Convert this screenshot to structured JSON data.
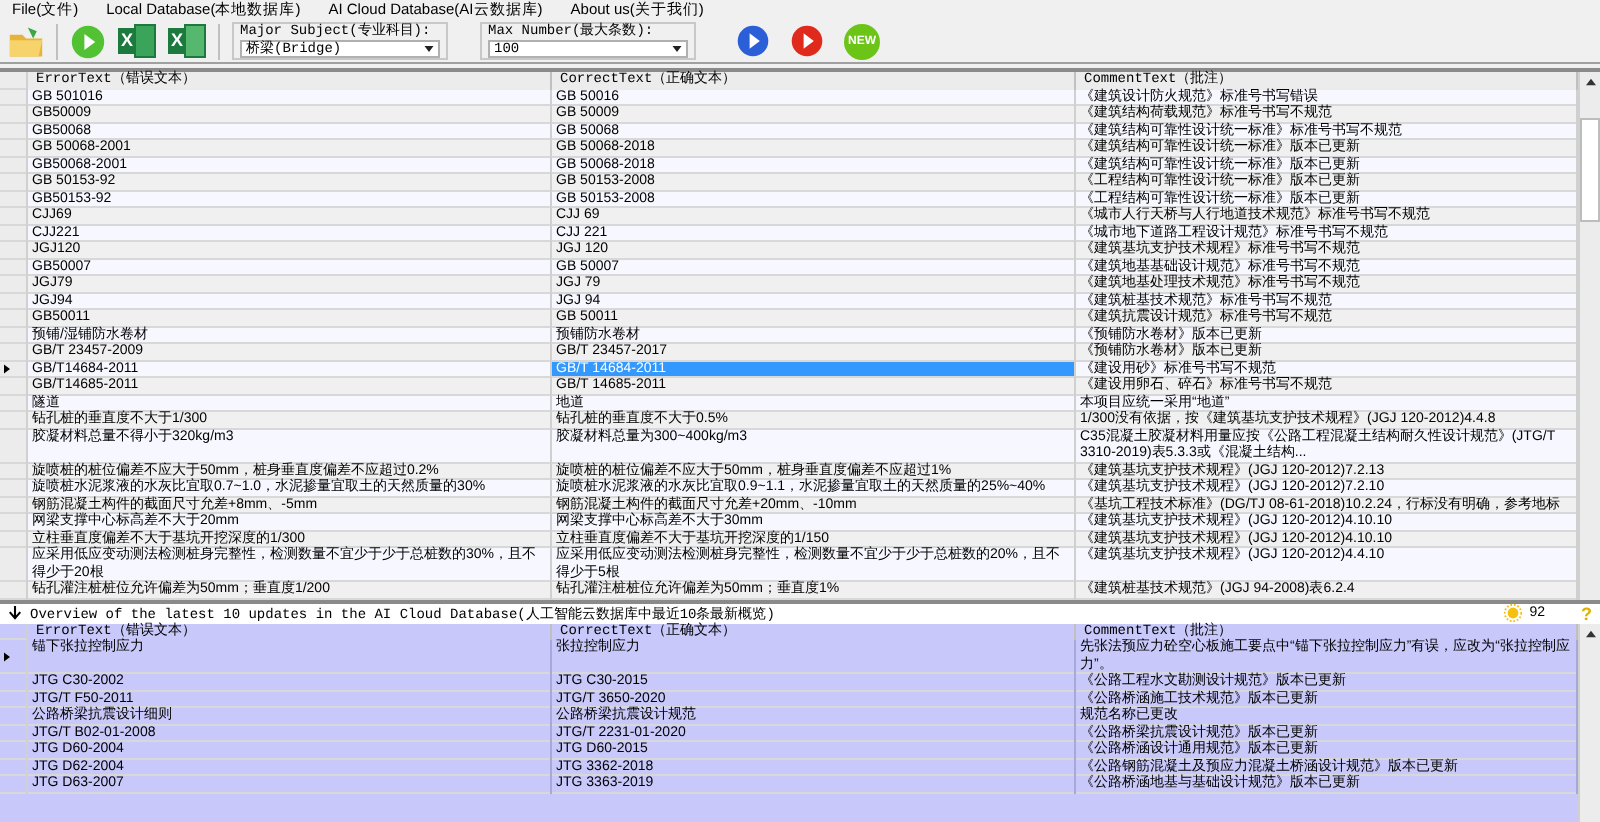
{
  "menu": [
    "File(文件)",
    "Local Database(本地数据库)",
    "AI Cloud Database(AI云数据库)",
    "About us(关于我们)"
  ],
  "toolbar": {
    "buttons": [
      {
        "kind": "folder"
      },
      {
        "kind": "run"
      },
      {
        "kind": "excel-export",
        "label": "X"
      },
      {
        "kind": "excel-import",
        "label": "X"
      }
    ],
    "fields": [
      {
        "legend": "Major Subject(专业科目):",
        "value": "桥梁(Bridge)"
      },
      {
        "legend": "Max Number(最大条数):",
        "value": "100"
      }
    ],
    "actions": [
      {
        "kind": "play-blue"
      },
      {
        "kind": "play-red"
      },
      {
        "kind": "new",
        "label": "NEW"
      }
    ]
  },
  "table": {
    "columns": [
      "ErrorText（错误文本）",
      "CorrectText（正确文本）",
      "CommentText（批注）"
    ],
    "rows": [
      {
        "error": "GB 501016",
        "correct": "GB 50016",
        "comment": "《建筑设计防火规范》标准号书写错误",
        "current": false,
        "selected": false
      },
      {
        "error": "GB50009",
        "correct": "GB 50009",
        "comment": "《建筑结构荷载规范》标准号书写不规范",
        "current": false,
        "selected": false
      },
      {
        "error": "GB50068",
        "correct": "GB 50068",
        "comment": "《建筑结构可靠性设计统一标准》标准号书写不规范",
        "current": false,
        "selected": false
      },
      {
        "error": "GB 50068-2001",
        "correct": "GB 50068-2018",
        "comment": "《建筑结构可靠性设计统一标准》版本已更新",
        "current": false,
        "selected": false
      },
      {
        "error": "GB50068-2001",
        "correct": "GB 50068-2018",
        "comment": "《建筑结构可靠性设计统一标准》版本已更新",
        "current": false,
        "selected": false
      },
      {
        "error": "GB 50153-92",
        "correct": "GB 50153-2008",
        "comment": "《工程结构可靠性设计统一标准》版本已更新",
        "current": false,
        "selected": false
      },
      {
        "error": "GB50153-92",
        "correct": "GB 50153-2008",
        "comment": "《工程结构可靠性设计统一标准》版本已更新",
        "current": false,
        "selected": false
      },
      {
        "error": "CJJ69",
        "correct": "CJJ 69",
        "comment": "《城市人行天桥与人行地道技术规范》标准号书写不规范",
        "current": false,
        "selected": false
      },
      {
        "error": "CJJ221",
        "correct": "CJJ 221",
        "comment": "《城市地下道路工程设计规范》标准号书写不规范",
        "current": false,
        "selected": false
      },
      {
        "error": "JGJ120",
        "correct": "JGJ 120",
        "comment": "《建筑基坑支护技术规程》标准号书写不规范",
        "current": false,
        "selected": false
      },
      {
        "error": "GB50007",
        "correct": "GB 50007",
        "comment": "《建筑地基基础设计规范》标准号书写不规范",
        "current": false,
        "selected": false
      },
      {
        "error": "JGJ79",
        "correct": "JGJ 79",
        "comment": "《建筑地基处理技术规范》标准号书写不规范",
        "current": false,
        "selected": false
      },
      {
        "error": "JGJ94",
        "correct": "JGJ 94",
        "comment": "《建筑桩基技术规范》标准号书写不规范",
        "current": false,
        "selected": false
      },
      {
        "error": "GB50011",
        "correct": "GB 50011",
        "comment": "《建筑抗震设计规范》标准号书写不规范",
        "current": false,
        "selected": false
      },
      {
        "error": "预铺/湿铺防水卷材",
        "correct": "预铺防水卷材",
        "comment": "《预铺防水卷材》版本已更新",
        "current": false,
        "selected": false
      },
      {
        "error": "GB/T 23457-2009",
        "correct": "GB/T 23457-2017",
        "comment": "《预铺防水卷材》版本已更新",
        "current": false,
        "selected": false
      },
      {
        "error": "GB/T14684-2011",
        "correct": "GB/T 14684-2011",
        "comment": "《建设用砂》标准号书写不规范",
        "current": true,
        "selected": true
      },
      {
        "error": "GB/T14685-2011",
        "correct": "GB/T 14685-2011",
        "comment": "《建设用卵石、碎石》标准号书写不规范",
        "current": false,
        "selected": false
      },
      {
        "error": "隧道",
        "correct": "地道",
        "comment": "本项目应统一采用“地道”",
        "current": false,
        "selected": false
      },
      {
        "error": "钻孔桩的垂直度不大于1/300",
        "correct": "钻孔桩的垂直度不大于0.5%",
        "comment": "1/300没有依据，按《建筑基坑支护技术规程》(JGJ 120-2012)4.4.8",
        "current": false,
        "selected": false
      },
      {
        "error": "胶凝材料总量不得小于320kg/m3",
        "correct": "胶凝材料总量为300~400kg/m3",
        "comment": "C35混凝土胶凝材料用量应按《公路工程混凝土结构耐久性设计规范》(JTG/T 3310-2019)表5.3.3或《混凝土结构...",
        "current": false,
        "selected": false
      },
      {
        "error": "旋喷桩的桩位偏差不应大于50mm，桩身垂直度偏差不应超过0.2%",
        "correct": "旋喷桩的桩位偏差不应大于50mm，桩身垂直度偏差不应超过1%",
        "comment": "《建筑基坑支护技术规程》(JGJ 120-2012)7.2.13",
        "current": false,
        "selected": false
      },
      {
        "error": "旋喷桩水泥浆液的水灰比宜取0.7~1.0，水泥掺量宜取土的天然质量的30%",
        "correct": "旋喷桩水泥浆液的水灰比宜取0.9~1.1，水泥掺量宜取土的天然质量的25%~40%",
        "comment": "《建筑基坑支护技术规程》(JGJ 120-2012)7.2.10",
        "current": false,
        "selected": false
      },
      {
        "error": "钢筋混凝土构件的截面尺寸允差+8mm、-5mm",
        "correct": "钢筋混凝土构件的截面尺寸允差+20mm、-10mm",
        "comment": "《基坑工程技术标准》(DG/TJ 08-61-2018)10.2.24，行标没有明确，参考地标",
        "current": false,
        "selected": false
      },
      {
        "error": "网梁支撑中心标高差不大于20mm",
        "correct": "网梁支撑中心标高差不大于30mm",
        "comment": "《建筑基坑支护技术规程》(JGJ 120-2012)4.10.10",
        "current": false,
        "selected": false
      },
      {
        "error": "立柱垂直度偏差不大于基坑开挖深度的1/300",
        "correct": "立柱垂直度偏差不大于基坑开挖深度的1/150",
        "comment": "《建筑基坑支护技术规程》(JGJ 120-2012)4.10.10",
        "current": false,
        "selected": false
      },
      {
        "error": "应采用低应变动测法检测桩身完整性，检测数量不宜少于少于总桩数的30%，且不得少于20根",
        "correct": "应采用低应变动测法检测桩身完整性，检测数量不宜少于少于总桩数的20%，且不得少于5根",
        "comment": "《建筑基坑支护技术规程》(JGJ 120-2012)4.4.10",
        "current": false,
        "selected": false
      },
      {
        "error": "钻孔灌注桩桩位允许偏差为50mm；垂直度1/200",
        "correct": "钻孔灌注桩桩位允许偏差为50mm；垂直度1%",
        "comment": "《建筑桩基技术规范》(JGJ 94-2008)表6.2.4",
        "current": false,
        "selected": false
      }
    ]
  },
  "overview": {
    "text": "Overview of the latest 10 updates in the AI Cloud Database(人工智能云数据库中最近10条最新概览)",
    "points": "92",
    "help": "?"
  },
  "updates": {
    "columns": [
      "ErrorText（错误文本）",
      "CorrectText（正确文本）",
      "CommentText（批注）"
    ],
    "rows": [
      {
        "error": "锚下张拉控制应力",
        "correct": "张拉控制应力",
        "comment": "先张法预应力砼空心板施工要点中“锚下张拉控制应力”有误，应改为“张拉控制应力”。",
        "current": true
      },
      {
        "error": "JTG C30-2002",
        "correct": "JTG C30-2015",
        "comment": "《公路工程水文勘测设计规范》版本已更新",
        "current": false
      },
      {
        "error": "JTG/T F50-2011",
        "correct": "JTG/T 3650-2020",
        "comment": "《公路桥涵施工技术规范》版本已更新",
        "current": false
      },
      {
        "error": "公路桥梁抗震设计细则",
        "correct": "公路桥梁抗震设计规范",
        "comment": "规范名称已更改",
        "current": false
      },
      {
        "error": "JTG/T B02-01-2008",
        "correct": "JTG/T 2231-01-2020",
        "comment": "《公路桥梁抗震设计规范》版本已更新",
        "current": false
      },
      {
        "error": "JTG D60-2004",
        "correct": "JTG D60-2015",
        "comment": "《公路桥涵设计通用规范》版本已更新",
        "current": false
      },
      {
        "error": "JTG D62-2004",
        "correct": "JTG 3362-2018",
        "comment": "《公路钢筋混凝土及预应力混凝土桥涵设计规范》版本已更新",
        "current": false
      },
      {
        "error": "JTG D63-2007",
        "correct": "JTG 3363-2019",
        "comment": "《公路桥涵地基与基础设计规范》版本已更新",
        "current": false
      }
    ]
  }
}
